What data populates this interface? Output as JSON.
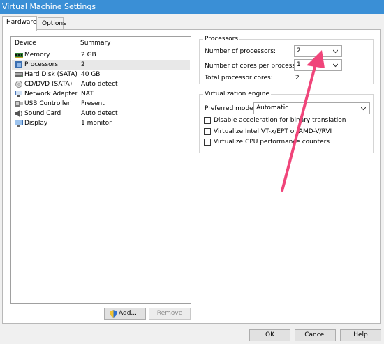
{
  "window": {
    "title": "Virtual Machine Settings"
  },
  "tabs": [
    {
      "label": "Hardware"
    },
    {
      "label": "Options"
    }
  ],
  "device_list": {
    "headers": {
      "device": "Device",
      "summary": "Summary"
    },
    "rows": [
      {
        "device": "Memory",
        "summary": "2 GB",
        "icon": "memory-icon"
      },
      {
        "device": "Processors",
        "summary": "2",
        "icon": "processor-icon"
      },
      {
        "device": "Hard Disk (SATA)",
        "summary": "40 GB",
        "icon": "hard-disk-icon"
      },
      {
        "device": "CD/DVD (SATA)",
        "summary": "Auto detect",
        "icon": "cd-dvd-icon"
      },
      {
        "device": "Network Adapter",
        "summary": "NAT",
        "icon": "network-adapter-icon"
      },
      {
        "device": "USB Controller",
        "summary": "Present",
        "icon": "usb-icon"
      },
      {
        "device": "Sound Card",
        "summary": "Auto detect",
        "icon": "sound-card-icon"
      },
      {
        "device": "Display",
        "summary": "1 monitor",
        "icon": "display-icon"
      }
    ],
    "selected_row": "Processors",
    "add_label": "Add...",
    "remove_label": "Remove"
  },
  "processors": {
    "title": "Processors",
    "num_processors_label": "Number of processors:",
    "num_processors_value": "2",
    "cores_label": "Number of cores per processor:",
    "cores_value": "1",
    "total_label": "Total processor cores:",
    "total_value": "2"
  },
  "virtualization": {
    "title": "Virtualization engine",
    "mode_label": "Preferred mode:",
    "mode_value": "Automatic",
    "options": [
      {
        "label": "Disable acceleration for binary translation",
        "checked": false
      },
      {
        "label": "Virtualize Intel VT-x/EPT or AMD-V/RVI",
        "checked": false
      },
      {
        "label": "Virtualize CPU performance counters",
        "checked": false
      }
    ]
  },
  "footer": {
    "ok": "OK",
    "cancel": "Cancel",
    "help": "Help"
  },
  "colors": {
    "title_bar": "#3a8fd6",
    "annotation_arrow": "#f0457a",
    "selected_row": "#e8e8e8"
  }
}
